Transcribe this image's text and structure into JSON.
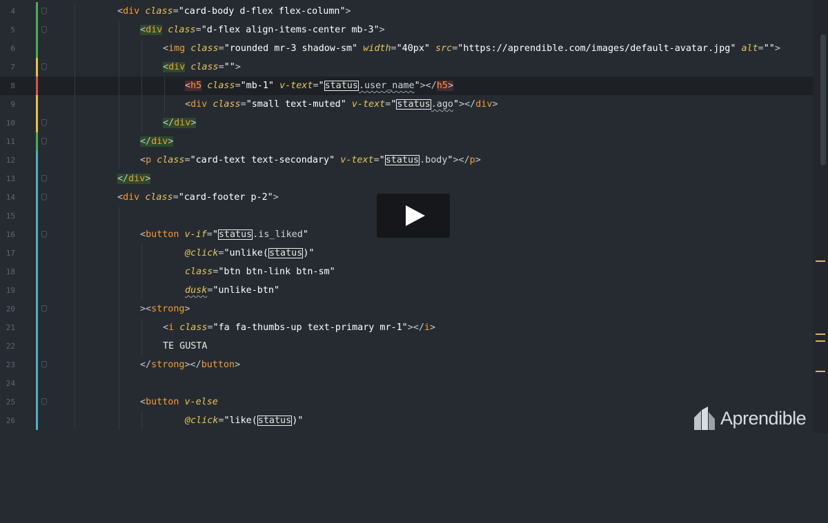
{
  "colors": {
    "background": "#262b32",
    "tag": "#f59c2f",
    "attribute": "#e8c55a",
    "string": "#ffffff",
    "change_green": "#4caf50",
    "change_yellow": "#e6c44a",
    "change_red": "#d9534f",
    "change_cyan": "#4fb3c7"
  },
  "brand": {
    "name": "Aprendible"
  },
  "video": {
    "play_icon": "play-icon"
  },
  "line_numbers": [
    "4",
    "5",
    "6",
    "7",
    "8",
    "9",
    "10",
    "11",
    "12",
    "13",
    "14",
    "15",
    "16",
    "17",
    "18",
    "19",
    "20",
    "21",
    "22",
    "23",
    "24",
    "25",
    "26"
  ],
  "code": {
    "l4": {
      "t1": "div",
      "a1": "class",
      "v1": "\"card-body d-flex flex-column\""
    },
    "l5": {
      "t1": "div",
      "a1": "class",
      "v1": "\"d-flex align-items-center mb-3\""
    },
    "l6": {
      "t1": "img",
      "a1": "class",
      "v1": "\"rounded mr-3 shadow-sm\"",
      "a2": "width",
      "v2": "\"40px\"",
      "a3": "src",
      "v3": "\"https://aprendible.com/images/default-avatar.jpg\"",
      "a4": "alt",
      "v4": "\"\""
    },
    "l7": {
      "t1": "div",
      "a1": "class",
      "v1": "\"\""
    },
    "l8": {
      "t1": "h5",
      "a1": "class",
      "v1": "\"mb-1\"",
      "a2": "v-text",
      "q": "\"",
      "obj": "status",
      "prop": ".user_name",
      "q2": "\"",
      "t2": "h5"
    },
    "l9": {
      "t1": "div",
      "a1": "class",
      "v1": "\"small text-muted\"",
      "a2": "v-text",
      "q": "\"",
      "obj": "status",
      "prop": ".ago",
      "q2": "\"",
      "t2": "div"
    },
    "l10": {
      "t1": "div"
    },
    "l11": {
      "t1": "div"
    },
    "l12": {
      "t1": "p",
      "a1": "class",
      "v1": "\"card-text text-secondary\"",
      "a2": "v-text",
      "q": "\"",
      "obj": "status",
      "prop": ".body",
      "q2": "\"",
      "t2": "p"
    },
    "l13": {
      "t1": "div"
    },
    "l14": {
      "t1": "div",
      "a1": "class",
      "v1": "\"card-footer p-2\""
    },
    "l16": {
      "t1": "button",
      "a1": "v-if",
      "q": "\"",
      "obj": "status",
      "prop": ".is_liked",
      "q2": "\""
    },
    "l17": {
      "a1": "@click",
      "q": "\"unlike(",
      "obj": "status",
      "q2": ")\""
    },
    "l18": {
      "a1": "class",
      "v1": "\"btn btn-link btn-sm\""
    },
    "l19": {
      "a1": "dusk",
      "v1": "\"unlike-btn\""
    },
    "l20": {
      "t1": "strong"
    },
    "l21": {
      "t1": "i",
      "a1": "class",
      "v1": "\"fa fa-thumbs-up text-primary mr-1\"",
      "t2": "i"
    },
    "l22": {
      "text": "TE GUSTA"
    },
    "l23": {
      "t1": "strong",
      "t2": "button"
    },
    "l25": {
      "t1": "button",
      "a1": "v-else"
    },
    "l26": {
      "a1": "@click",
      "q": "\"like(",
      "obj": "status",
      "q2": ")\""
    }
  }
}
